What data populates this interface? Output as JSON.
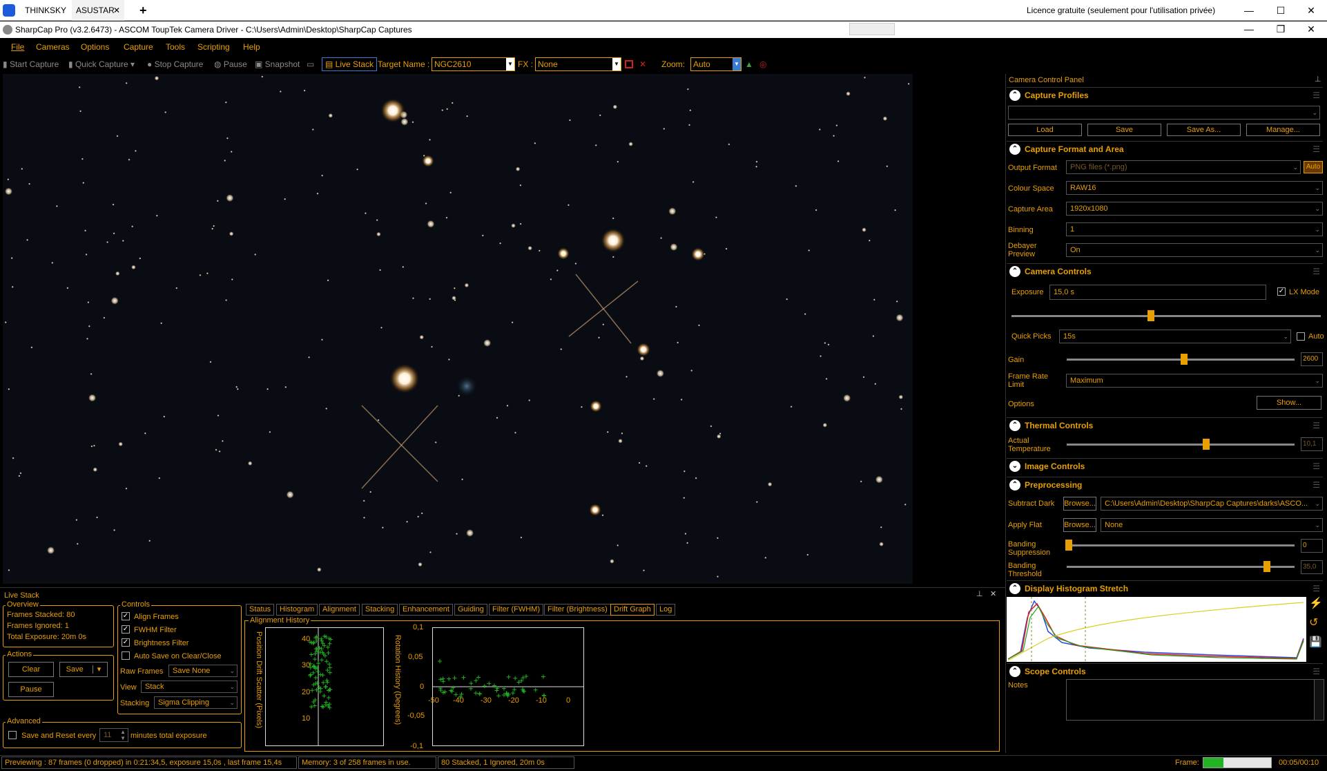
{
  "remote": {
    "tabs": [
      "THINKSKY",
      "ASUSTAR"
    ],
    "licence": "Licence gratuite (seulement pour l'utilisation privée)"
  },
  "window": {
    "title": "SharpCap Pro (v3.2.6473) - ASCOM ToupTek Camera Driver - C:\\Users\\Admin\\Desktop\\SharpCap Captures"
  },
  "menu": [
    "File",
    "Cameras",
    "Options",
    "Capture",
    "Tools",
    "Scripting",
    "Help"
  ],
  "toolbar": {
    "start_capture": "Start Capture",
    "quick_capture": "Quick Capture",
    "stop_capture": "Stop Capture",
    "pause": "Pause",
    "snapshot": "Snapshot",
    "live_stack": "Live Stack",
    "target_label": "Target Name :",
    "target_value": "NGC2610",
    "fx_label": "FX :",
    "fx_value": "None",
    "zoom_label": "Zoom:",
    "zoom_value": "Auto"
  },
  "ccp": {
    "title": "Camera Control Panel",
    "capture_profiles": {
      "title": "Capture Profiles",
      "buttons": [
        "Load",
        "Save",
        "Save As...",
        "Manage..."
      ]
    },
    "capture_format": {
      "title": "Capture Format and Area",
      "rows": [
        {
          "label": "Output Format",
          "value": "PNG files (*.png)"
        },
        {
          "label": "Colour Space",
          "value": "RAW16"
        },
        {
          "label": "Capture Area",
          "value": "1920x1080"
        },
        {
          "label": "Binning",
          "value": "1"
        },
        {
          "label": "Debayer Preview",
          "value": "On"
        }
      ],
      "auto": "Auto"
    },
    "camera_controls": {
      "title": "Camera Controls",
      "exposure_label": "Exposure",
      "exposure_value": "15,0 s",
      "exposure_level": 0.45,
      "lx_mode": "LX Mode",
      "quick_picks_label": "Quick Picks",
      "quick_picks_value": "15s",
      "auto": "Auto",
      "gain_label": "Gain",
      "gain_value": "2600",
      "gain_level": 0.5,
      "frame_rate_label": "Frame Rate Limit",
      "frame_rate_value": "Maximum",
      "options_label": "Options",
      "show": "Show..."
    },
    "thermal": {
      "title": "Thermal Controls",
      "temp_label": "Actual Temperature",
      "temp_value": "10,1",
      "temp_level": 0.6
    },
    "image_controls": {
      "title": "Image Controls"
    },
    "preprocessing": {
      "title": "Preprocessing",
      "subtract_dark_label": "Subtract Dark",
      "browse": "Browse...",
      "dark_path": "C:\\Users\\Admin\\Desktop\\SharpCap Captures\\darks\\ASCO...",
      "apply_flat_label": "Apply Flat",
      "flat_value": "None",
      "banding_sup_label": "Banding Suppression",
      "banding_sup_value": "0",
      "banding_sup_level": 0.0,
      "banding_thr_label": "Banding Threshold",
      "banding_thr_value": "35,0",
      "banding_thr_level": 0.87
    },
    "histogram": {
      "title": "Display Histogram Stretch"
    },
    "scope": {
      "title": "Scope Controls",
      "notes_label": "Notes"
    }
  },
  "live_stack": {
    "title": "Live Stack",
    "overview": {
      "title": "Overview",
      "frames_stacked": "Frames Stacked: 80",
      "frames_ignored": "Frames Ignored:  1",
      "total_exposure": "Total Exposure:  20m 0s"
    },
    "actions": {
      "title": "Actions",
      "clear": "Clear",
      "save": "Save",
      "pause": "Pause"
    },
    "advanced": {
      "title": "Advanced",
      "save_reset": "Save and Reset every",
      "minutes_value": "11",
      "minutes_label": "minutes total exposure"
    },
    "controls": {
      "title": "Controls",
      "align": "Align Frames",
      "fwhm": "FWHM Filter",
      "brightness": "Brightness Filter",
      "autosave": "Auto Save on Clear/Close",
      "raw_frames_label": "Raw Frames",
      "raw_frames_value": "Save None",
      "view_label": "View",
      "view_value": "Stack",
      "stacking_label": "Stacking",
      "stacking_value": "Sigma Clipping"
    },
    "tabs": [
      "Status",
      "Histogram",
      "Alignment",
      "Stacking",
      "Enhancement",
      "Guiding",
      "Filter (FWHM)",
      "Filter (Brightness)",
      "Drift Graph",
      "Log"
    ],
    "alignment_history": "Alignment History",
    "pos_axis_label": "Position Drift Scatter (Pixels)",
    "rot_axis_label": "Rotation History (Degrees)",
    "pos_ticks": [
      "40",
      "30",
      "20",
      "10"
    ],
    "rot_y_ticks": [
      "0,1",
      "0,05",
      "0",
      "-0,05",
      "-0,1"
    ],
    "rot_x_ticks": [
      "-50",
      "-40",
      "-30",
      "-20",
      "-10",
      "0"
    ]
  },
  "status": {
    "preview": "Previewing : 87 frames (0 dropped) in 0:21:34,5, exposure 15,0s , last frame 15,4s",
    "memory": "Memory: 3 of 258 frames in use.",
    "stacked": "80 Stacked, 1 Ignored, 20m 0s",
    "frame_label": "Frame:",
    "frame_time": "00:05/00:10",
    "frame_progress": 0.3
  }
}
